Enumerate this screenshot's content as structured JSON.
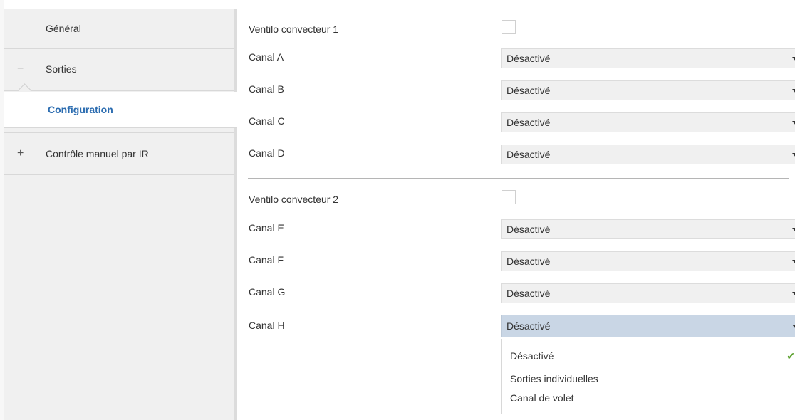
{
  "sidebar": {
    "items": [
      {
        "label": "Général",
        "sign": ""
      },
      {
        "label": "Sorties",
        "sign": "−"
      },
      {
        "label": "Configuration",
        "sign": ""
      },
      {
        "label": "Contrôle manuel par IR",
        "sign": "+"
      }
    ]
  },
  "main": {
    "group1": {
      "title": "Ventilo convecteur 1",
      "channels": [
        {
          "label": "Canal A",
          "value": "Désactivé"
        },
        {
          "label": "Canal B",
          "value": "Désactivé"
        },
        {
          "label": "Canal C",
          "value": "Désactivé"
        },
        {
          "label": "Canal D",
          "value": "Désactivé"
        }
      ]
    },
    "group2": {
      "title": "Ventilo convecteur 2",
      "channels": [
        {
          "label": "Canal E",
          "value": "Désactivé"
        },
        {
          "label": "Canal F",
          "value": "Désactivé"
        },
        {
          "label": "Canal G",
          "value": "Désactivé"
        },
        {
          "label": "Canal H",
          "value": "Désactivé"
        }
      ]
    },
    "dropdown_options": [
      "Désactivé",
      "Sorties individuelles",
      "Canal de volet"
    ],
    "selected_check": "✔"
  }
}
